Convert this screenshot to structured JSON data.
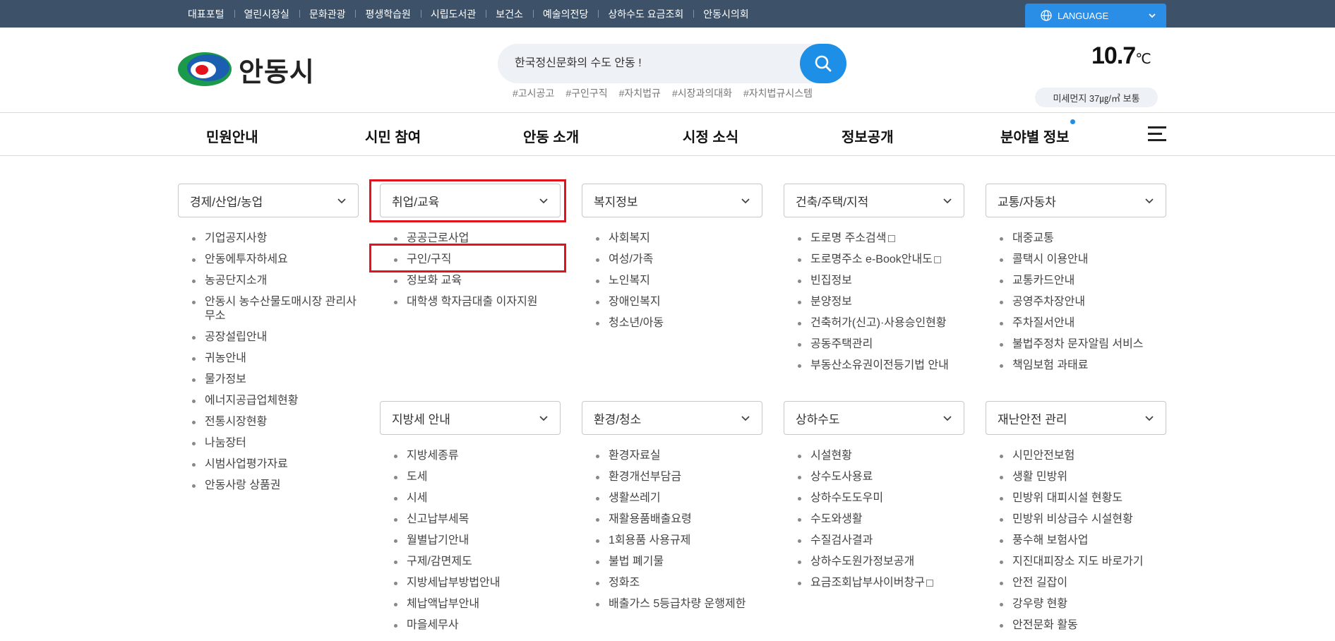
{
  "topbar": {
    "links": [
      "대표포털",
      "열린시장실",
      "문화관광",
      "평생학습원",
      "시립도서관",
      "보건소",
      "예술의전당",
      "상하수도 요금조회",
      "안동시의회"
    ],
    "language_label": "LANGUAGE",
    "bg_color": "#3d5269",
    "lang_color": "#2b8ee6"
  },
  "header": {
    "logo_text": "안동시",
    "search_placeholder": "한국정신문화의 수도 안동 !",
    "hashtags": [
      "#고시공고",
      "#구인구직",
      "#자치법규",
      "#시장과의대화",
      "#자치법규시스템"
    ],
    "temperature": "10.7",
    "temp_unit": "℃",
    "dust": "미세먼지 37㎍/㎥ 보통"
  },
  "gnb": {
    "items": [
      "민원안내",
      "시민 참여",
      "안동 소개",
      "시정 소식",
      "정보공개",
      "분야별 정보"
    ]
  },
  "categories": [
    {
      "title": "경제/산업/농업",
      "items": [
        "기업공지사항",
        "안동에투자하세요",
        "농공단지소개",
        "안동시 농수산물도매시장 관리사무소",
        "공장설립안내",
        "귀농안내",
        "물가정보",
        "에너지공급업체현황",
        "전통시장현황",
        "나눔장터",
        "시범사업평가자료",
        "안동사랑 상품권"
      ]
    },
    {
      "title": "취업/교육",
      "items": [
        "공공근로사업",
        "구인/구직",
        "정보화 교육",
        "대학생 학자금대출 이자지원"
      ]
    },
    {
      "title": "복지정보",
      "items": [
        "사회복지",
        "여성/가족",
        "노인복지",
        "장애인복지",
        "청소년/아동"
      ]
    },
    {
      "title": "건축/주택/지적",
      "items": [
        "도로명 주소검색",
        "도로명주소 e-Book안내도",
        "빈집정보",
        "분양정보",
        "건축허가(신고)·사용승인현황",
        "공동주택관리",
        "부동산소유권이전등기법 안내"
      ]
    },
    {
      "title": "교통/자동차",
      "items": [
        "대중교통",
        "콜택시 이용안내",
        "교통카드안내",
        "공영주차장안내",
        "주차질서안내",
        "불법주정차 문자알림 서비스",
        "책임보험 과태료"
      ]
    },
    {
      "title": "지방세 안내",
      "items": [
        "지방세종류",
        "도세",
        "시세",
        "신고납부세목",
        "월별납기안내",
        "구제/감면제도",
        "지방세납부방법안내",
        "체납액납부안내",
        "마을세무사"
      ]
    },
    {
      "title": "환경/청소",
      "items": [
        "환경자료실",
        "환경개선부담금",
        "생활쓰레기",
        "재활용품배출요령",
        "1회용품 사용규제",
        "불법 폐기물",
        "정화조",
        "배출가스 5등급차량 운행제한"
      ]
    },
    {
      "title": "상하수도",
      "items": [
        "시설현황",
        "상수도사용료",
        "상하수도도우미",
        "수도와생활",
        "수질검사결과",
        "상하수도원가정보공개",
        "요금조회납부사이버창구"
      ]
    },
    {
      "title": "재난안전 관리",
      "items": [
        "시민안전보험",
        "생활 민방위",
        "민방위 대피시설 현황도",
        "민방위 비상급수 시설현황",
        "풍수해 보험사업",
        "지진대피장소 지도 바로가기",
        "안전 길잡이",
        "강우량 현황",
        "안전문화 활동"
      ]
    }
  ],
  "highlight_color": "#e2131c"
}
